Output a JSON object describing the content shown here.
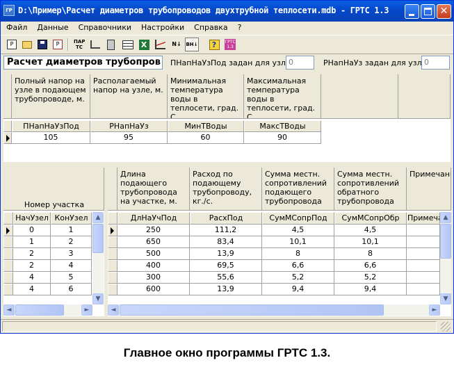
{
  "window": {
    "title": "D:\\Пример\\Расчет диаметров трубопроводов двухтрубной теплосети.mdb - ГРТС 1.3",
    "icon_label": "ГР"
  },
  "menu": [
    "Файл",
    "Данные",
    "Справочники",
    "Настройки",
    "Справка",
    "?"
  ],
  "toolbar": {
    "buttons": [
      {
        "icon": "report-icon",
        "text": "P"
      },
      {
        "icon": "open-folder-icon",
        "text": ""
      },
      {
        "icon": "save-disk-icon",
        "text": ""
      },
      {
        "icon": "print-report-icon",
        "text": "P"
      },
      {
        "icon": "parameters-icon",
        "text": "ПАР ТС"
      },
      {
        "icon": "network-scheme-icon",
        "text": ""
      },
      {
        "icon": "calculator-icon",
        "text": ""
      },
      {
        "icon": "table-icon",
        "text": ""
      },
      {
        "icon": "excel-icon",
        "text": "X"
      },
      {
        "icon": "chart-icon",
        "text": ""
      },
      {
        "icon": "sort-icon",
        "text": "N↓"
      },
      {
        "icon": "sort-vn-icon",
        "text": "ВН↓"
      },
      {
        "icon": "help-icon",
        "text": "?"
      },
      {
        "icon": "about-icon",
        "text": "ГРТС 1.3"
      }
    ]
  },
  "header": {
    "title": "Расчет диаметров трубопров",
    "supply_label": "ПНапНаУзПод задан для узла:",
    "supply_value": "0",
    "return_label": "РНапНаУз задан для узла:",
    "return_value": "0"
  },
  "top_grid": {
    "descriptions": [
      "Полный напор на узле в подающем трубопроводе, м.",
      "Располагаемый напор на узле, м.",
      "Минимальная температура воды в теплосети, град. С",
      "Максимальная температура воды в теплосети, град. С",
      "",
      ""
    ],
    "columns": [
      "ПНапНаУзПод",
      "РНапНаУз",
      "МинТВоды",
      "МаксТВоды"
    ],
    "rows": [
      [
        "105",
        "95",
        "60",
        "90"
      ]
    ]
  },
  "left_grid": {
    "caption": "Номер участка",
    "columns": [
      "НачУзел",
      "КонУзел"
    ],
    "rows": [
      [
        "0",
        "1"
      ],
      [
        "1",
        "2"
      ],
      [
        "2",
        "3"
      ],
      [
        "2",
        "4"
      ],
      [
        "4",
        "5"
      ],
      [
        "4",
        "6"
      ]
    ]
  },
  "right_grid": {
    "descriptions": [
      "Длина подающего трубопровода на участке, м.",
      "Расход по подающему трубопроводу, кг./с.",
      "Сумма местн. сопротивлений подающего трубопровода",
      "Сумма местн. сопротивлений обратного трубопровода",
      "Примечание"
    ],
    "columns": [
      "ДлНаУчПод",
      "РасхПод",
      "СумМСопрПод",
      "СумМСопрОбр",
      "Примеча"
    ],
    "rows": [
      [
        "250",
        "111,2",
        "4,5",
        "4,5",
        ""
      ],
      [
        "650",
        "83,4",
        "10,1",
        "10,1",
        ""
      ],
      [
        "500",
        "13,9",
        "8",
        "8",
        ""
      ],
      [
        "400",
        "69,5",
        "6,6",
        "6,6",
        ""
      ],
      [
        "300",
        "55,6",
        "5,2",
        "5,2",
        ""
      ],
      [
        "600",
        "13,9",
        "9,4",
        "9,4",
        ""
      ]
    ]
  },
  "scroll_glyphs": {
    "up": "▲",
    "down": "▼",
    "left": "◄",
    "right": "►"
  },
  "caption": "Главное окно программы ГРТС 1.3."
}
